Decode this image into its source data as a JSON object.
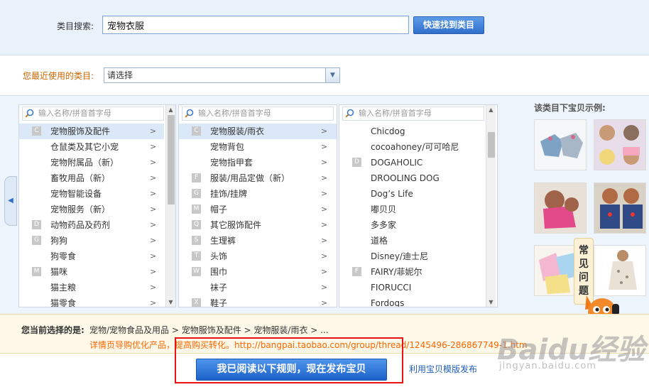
{
  "search": {
    "label": "类目搜索:",
    "value": "宠物衣服",
    "button": "快速找到类目"
  },
  "recent": {
    "label": "您最近使用的类目:",
    "select_value": "请选择"
  },
  "columns": {
    "filter_placeholder": "输入名称/拼音首字母",
    "col1": [
      {
        "letter": "C",
        "label": "宠物服饰及配件",
        "selected": true
      },
      {
        "letter": "",
        "label": "仓鼠类及其它小宠"
      },
      {
        "letter": "",
        "label": "宠物附属品（新）"
      },
      {
        "letter": "",
        "label": "畜牧用品（新）"
      },
      {
        "letter": "",
        "label": "宠物智能设备"
      },
      {
        "letter": "",
        "label": "宠物服务（新）"
      },
      {
        "letter": "D",
        "label": "动物药品及药剂"
      },
      {
        "letter": "G",
        "label": "狗狗"
      },
      {
        "letter": "",
        "label": "狗零食"
      },
      {
        "letter": "M",
        "label": "猫咪"
      },
      {
        "letter": "",
        "label": "猫主粮"
      },
      {
        "letter": "",
        "label": "猫零食"
      }
    ],
    "col2": [
      {
        "letter": "C",
        "label": "宠物服装/雨衣",
        "selected": true
      },
      {
        "letter": "",
        "label": "宠物背包"
      },
      {
        "letter": "",
        "label": "宠物指甲套"
      },
      {
        "letter": "F",
        "label": "服装/用品定做（新）"
      },
      {
        "letter": "G",
        "label": "挂饰/挂牌"
      },
      {
        "letter": "M",
        "label": "帽子"
      },
      {
        "letter": "Q",
        "label": "其它服饰配件"
      },
      {
        "letter": "S",
        "label": "生理裤"
      },
      {
        "letter": "T",
        "label": "头饰"
      },
      {
        "letter": "W",
        "label": "围巾"
      },
      {
        "letter": "",
        "label": "袜子"
      },
      {
        "letter": "X",
        "label": "鞋子"
      }
    ],
    "col3": [
      {
        "letter": "",
        "label": "Chicdog"
      },
      {
        "letter": "",
        "label": "cocoahoney/可可哈尼"
      },
      {
        "letter": "D",
        "label": "DOGAHOLIC"
      },
      {
        "letter": "",
        "label": "DROOLING DOG"
      },
      {
        "letter": "",
        "label": "Dog’s Life"
      },
      {
        "letter": "",
        "label": "嘟贝贝"
      },
      {
        "letter": "",
        "label": "多多家"
      },
      {
        "letter": "",
        "label": "道格"
      },
      {
        "letter": "",
        "label": "Disney/迪士尼"
      },
      {
        "letter": "F",
        "label": "FAIRY/菲妮尔"
      },
      {
        "letter": "",
        "label": "FIORUCCI"
      },
      {
        "letter": "",
        "label": "Fordogs"
      }
    ]
  },
  "examples": {
    "title": "该类目下宝贝示例:",
    "faq": "常见问题"
  },
  "selection": {
    "label": "您当前选择的是:",
    "path": "宠物/宠物食品及用品 > 宠物服饰及配件 > 宠物服装/雨衣 > ...",
    "tip": "详情页导购优化产品，提高购买转化。http://bangpai.taobao.com/group/thread/1245496-286867749-1.htm"
  },
  "actions": {
    "publish": "我已阅读以下规则，现在发布宝贝",
    "template_link": "利用宝贝模版发布"
  },
  "watermark": {
    "logo": "Baidu经验",
    "url": "jingyan.baidu.com"
  },
  "colors": {
    "accent": "#2f6fcb",
    "highlight": "#ff6600",
    "frame": "#ee1111"
  }
}
